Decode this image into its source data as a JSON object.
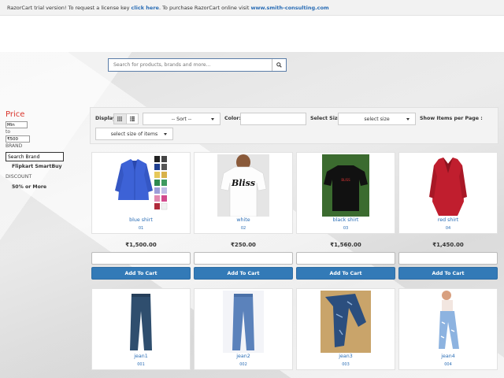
{
  "trial_bar": {
    "text_before": "RazorCart trial version! To request a license key ",
    "click_here": "click here",
    "text_middle": ". To purchase RazorCart online visit ",
    "site_link": "www.smith-consulting.com"
  },
  "search": {
    "placeholder": "Search for products, brands and more..."
  },
  "sidebar": {
    "price_title": "Price",
    "min_value": "Min",
    "to_label": "to",
    "max_value": "₹500",
    "brand_label": "BRAND",
    "brand_search_value": "Search Brand",
    "brands": [
      "Flipkart SmartBuy"
    ],
    "discount_label": "DISCOUNT",
    "discounts": [
      "50% or More"
    ]
  },
  "filters": {
    "display_label": "Display",
    "sort_value": "-- Sort --",
    "color_label": "Color:",
    "size_label": "Select Size:",
    "size_value": "select size",
    "show_items_label": "Show Items per Page :",
    "items_size_value": "select size of items"
  },
  "products": [
    {
      "name": "blue shirt",
      "code": "01",
      "price": "₹1,500.00",
      "button": "Add To Cart"
    },
    {
      "name": "white",
      "code": "02",
      "price": "₹250.00",
      "button": "Add To Cart"
    },
    {
      "name": "black shirt",
      "code": "03",
      "price": "₹1,560.00",
      "button": "Add To Cart"
    },
    {
      "name": "red shirt",
      "code": "04",
      "price": "₹1,450.00",
      "button": "Add To Cart"
    },
    {
      "name": "jean1",
      "code": "001"
    },
    {
      "name": "jean2",
      "code": "002"
    },
    {
      "name": "jean3",
      "code": "003"
    },
    {
      "name": "jean4",
      "code": "004"
    }
  ],
  "product_image_text": {
    "bliss": "Bliss",
    "black_shirt_logo": "BLISS"
  },
  "colors": {
    "link": "#2a6db5",
    "price_title": "#d9342b",
    "button": "#337ab7"
  }
}
